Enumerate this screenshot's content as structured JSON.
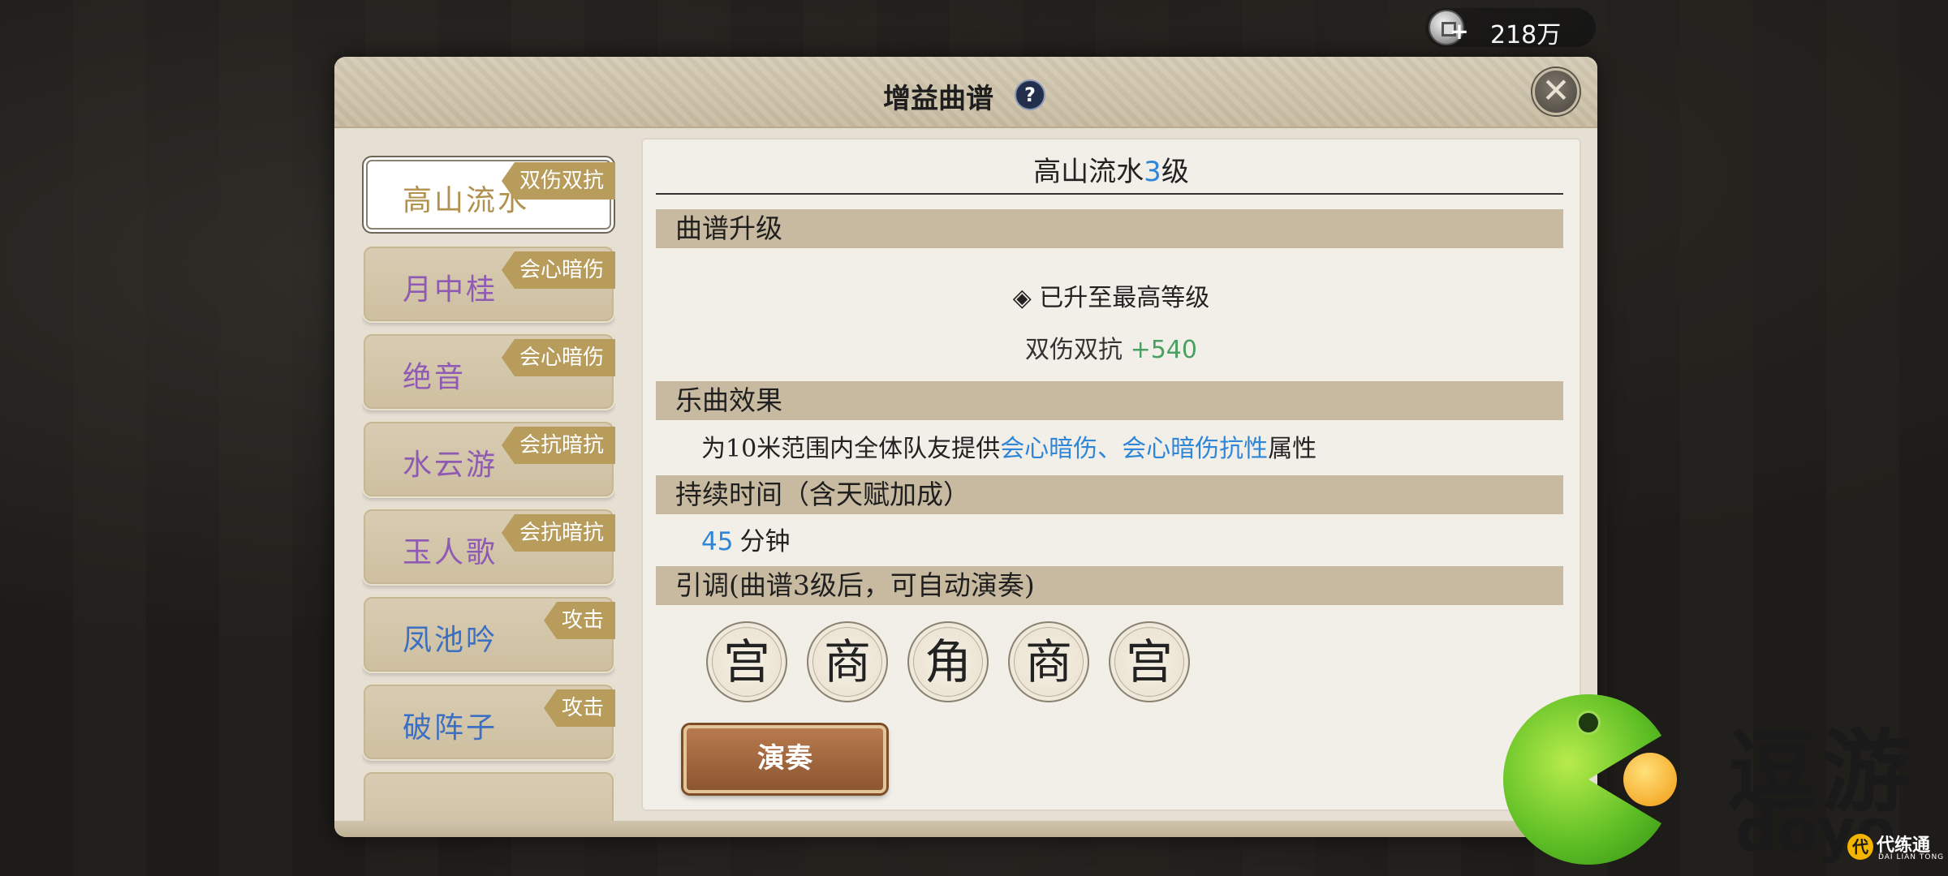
{
  "currency": {
    "value": "218万",
    "icon": "silver-coin-icon"
  },
  "dialog": {
    "title": "增益曲谱",
    "help_label": "?",
    "close_label": "✕"
  },
  "songs": [
    {
      "name": "高山流水",
      "tag": "双伤双抗",
      "selected": true,
      "color": "#b1914f"
    },
    {
      "name": "月中桂",
      "tag": "会心暗伤",
      "selected": false,
      "color": "#8e5ab3"
    },
    {
      "name": "绝音",
      "tag": "会心暗伤",
      "selected": false,
      "color": "#8e5ab3"
    },
    {
      "name": "水云游",
      "tag": "会抗暗抗",
      "selected": false,
      "color": "#8e5ab3"
    },
    {
      "name": "玉人歌",
      "tag": "会抗暗抗",
      "selected": false,
      "color": "#8e5ab3"
    },
    {
      "name": "凤池吟",
      "tag": "攻击",
      "selected": false,
      "color": "#3b6fc4"
    },
    {
      "name": "破阵子",
      "tag": "攻击",
      "selected": false,
      "color": "#3b6fc4"
    }
  ],
  "detail": {
    "title_prefix": "高山流水",
    "level": "3",
    "title_suffix": "级",
    "upgrade_header": "曲谱升级",
    "max_level_text": "◈ 已升至最高等级",
    "bonus_label": "双伤双抗 ",
    "bonus_value": "+540",
    "effect_header": "乐曲效果",
    "effect_prefix": "为10米范围内全体队友提供",
    "effect_highlight": "会心暗伤、会心暗伤抗性",
    "effect_suffix": "属性",
    "duration_header": "持续时间（含天赋加成）",
    "duration_value": "45",
    "duration_unit": "分钟",
    "tune_header": "引调(曲谱3级后，可自动演奏)",
    "notes": [
      "宫",
      "商",
      "角",
      "商",
      "宫"
    ],
    "play_label": "演奏"
  },
  "watermarks": {
    "doyo_text": "逗游",
    "doyo_sub": "doyo",
    "dailiantong_icon": "代",
    "dailiantong_text": "代练通",
    "dailiantong_sub": "DAI LIAN TONG"
  },
  "colors": {
    "accent_blue": "#2f86d8",
    "bonus_green": "#4aa062",
    "tag_gold": "#b79c5c",
    "section_bar": "#c8baa0"
  }
}
